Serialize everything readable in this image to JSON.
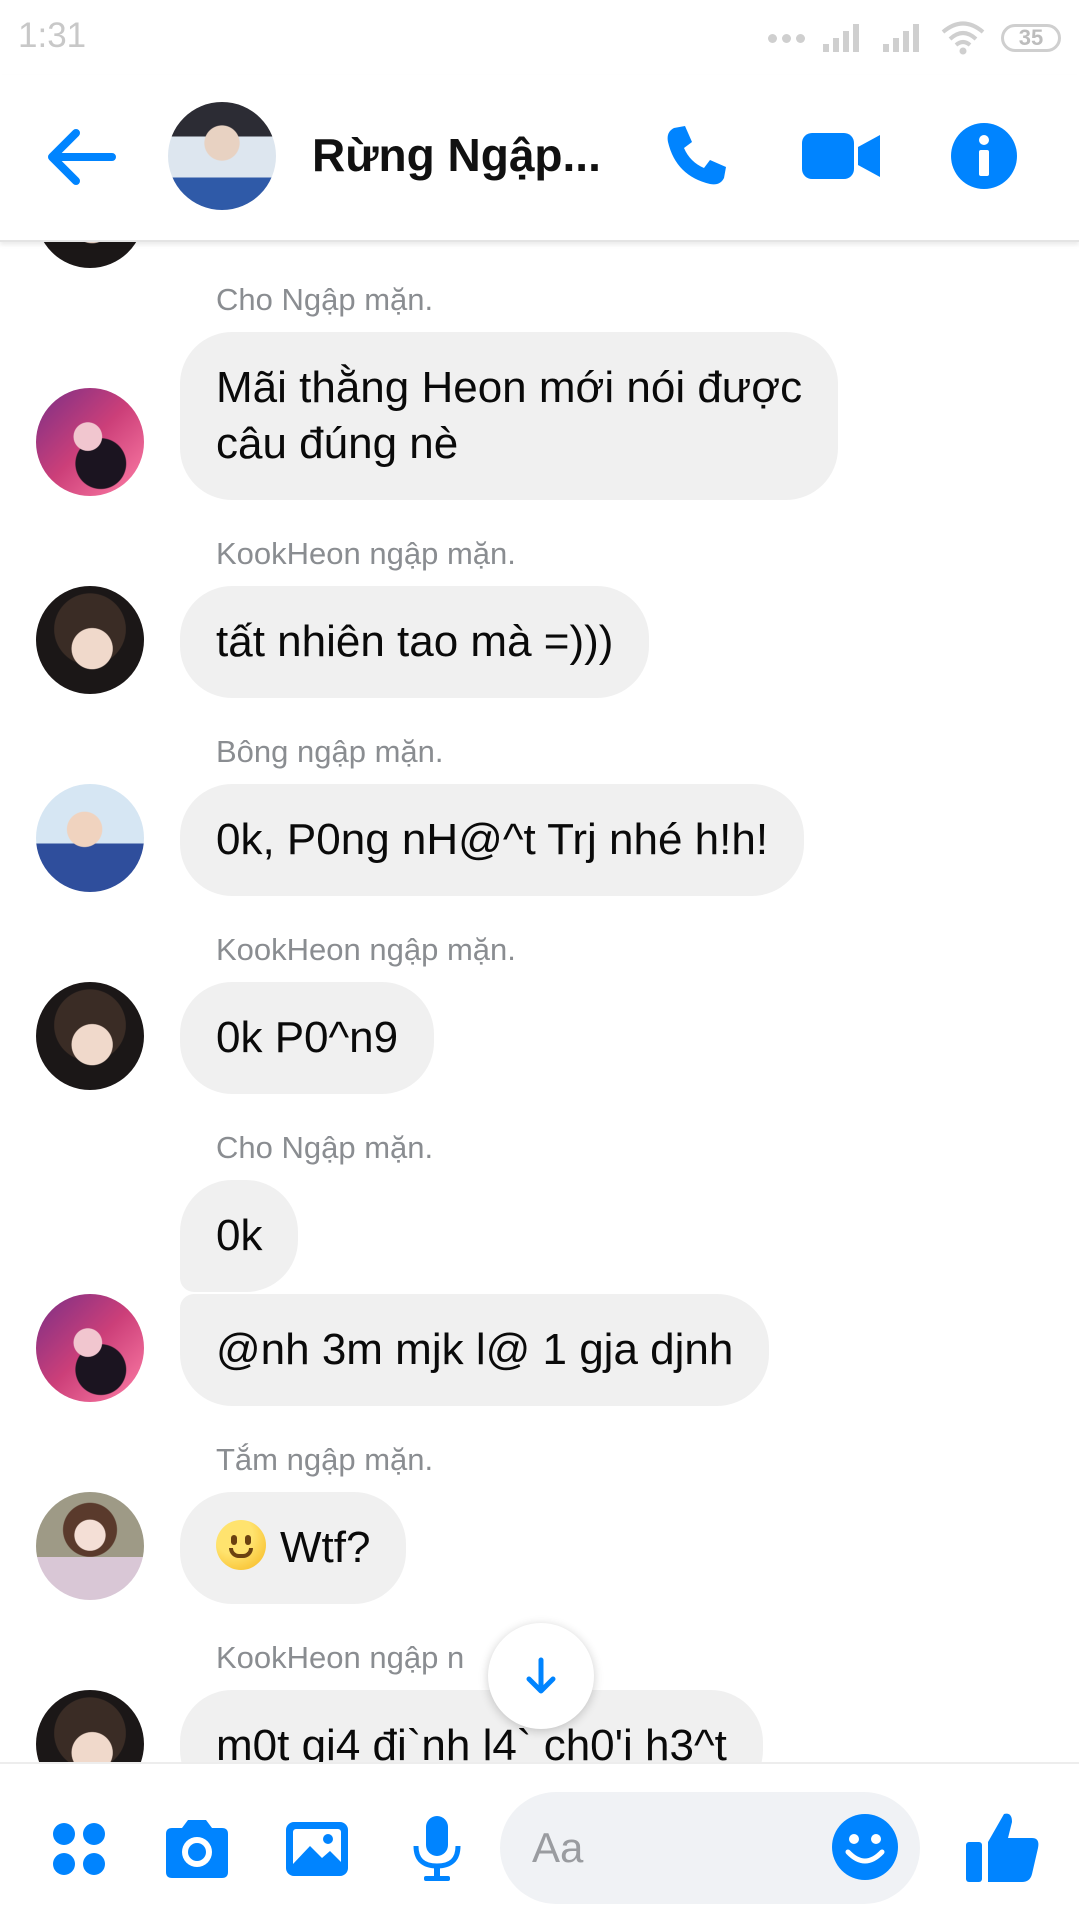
{
  "status_bar": {
    "time": "1:31",
    "battery": "35"
  },
  "header": {
    "title": "Rừng Ngập..."
  },
  "messages": [
    {
      "sender": "Cho Ngập mặn.",
      "lines": [
        "Mãi thằng Heon mới nói được",
        "câu đúng nè"
      ]
    },
    {
      "sender": "KookHeon ngập mặn.",
      "text": "tất nhiên tao mà =)))"
    },
    {
      "sender": "Bông ngập mặn.",
      "text": "0k, P0ng nH@^t Trj nhé h!h!"
    },
    {
      "sender": "KookHeon ngập mặn.",
      "text": "0k P0^n9"
    },
    {
      "sender": "Cho Ngập mặn.",
      "texts": [
        "0k",
        "@nh 3m mjk l@ 1 gja djnh"
      ]
    },
    {
      "sender": "Tắm ngập mặn.",
      "text": "Wtf?"
    },
    {
      "sender": "KookHeon ngập n",
      "text": "m0t gi4 đi`nh l4` ch0'i h3^t"
    }
  ],
  "composer": {
    "placeholder": "Aa"
  },
  "colors": {
    "accent": "#0084ff",
    "bubble": "#f0f0f0",
    "sender_label": "#8a8d91"
  },
  "icons": [
    "back-arrow-icon",
    "phone-icon",
    "video-camera-icon",
    "info-icon",
    "arrow-down-icon",
    "menu-dots-icon",
    "camera-icon",
    "gallery-icon",
    "microphone-icon",
    "smiley-icon",
    "thumbs-up-icon"
  ]
}
